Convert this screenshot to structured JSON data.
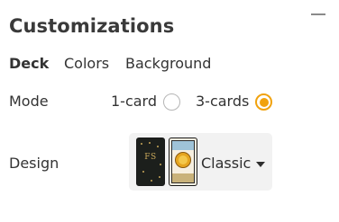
{
  "panel": {
    "title": "Customizations",
    "collapse_icon": "minus-icon"
  },
  "tabs": [
    {
      "label": "Deck",
      "active": true
    },
    {
      "label": "Colors",
      "active": false
    },
    {
      "label": "Background",
      "active": false
    }
  ],
  "mode": {
    "label": "Mode",
    "options": [
      {
        "label": "1-card",
        "selected": false
      },
      {
        "label": "3-cards",
        "selected": true
      }
    ]
  },
  "design": {
    "label": "Design",
    "selected_value": "Classic",
    "back_monogram": "FS",
    "dropdown_icon": "caret-down-icon"
  },
  "colors": {
    "accent": "#f1a20d",
    "select_bg": "#f2f2f2",
    "text": "#333333"
  }
}
